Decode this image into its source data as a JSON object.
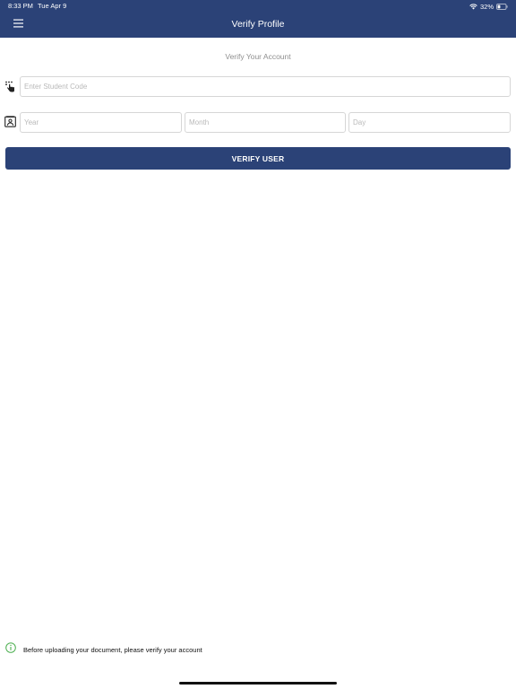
{
  "status_bar": {
    "time": "8:33 PM",
    "date": "Tue Apr 9",
    "battery": "32%",
    "icons": [
      "wifi-icon",
      "battery-icon"
    ]
  },
  "nav": {
    "title": "Verify Profile",
    "menu_icon": "hamburger-menu-icon"
  },
  "form": {
    "subtitle": "Verify Your Account",
    "student_code": {
      "value": "",
      "placeholder": "Enter Student Code",
      "icon": "tap-hand-icon"
    },
    "birth_date": {
      "icon": "id-card-icon",
      "year": {
        "value": "",
        "placeholder": "Year"
      },
      "month": {
        "value": "",
        "placeholder": "Month"
      },
      "day": {
        "value": "",
        "placeholder": "Day"
      }
    },
    "submit_label": "VERIFY USER"
  },
  "footer": {
    "info_icon": "info-circle-icon",
    "message": "Before uploading your document, please verify your account"
  },
  "colors": {
    "primary": "#2b4277",
    "info_green": "#4caf50",
    "placeholder": "#b9b9b9",
    "subtitle": "#8f8f8f"
  }
}
